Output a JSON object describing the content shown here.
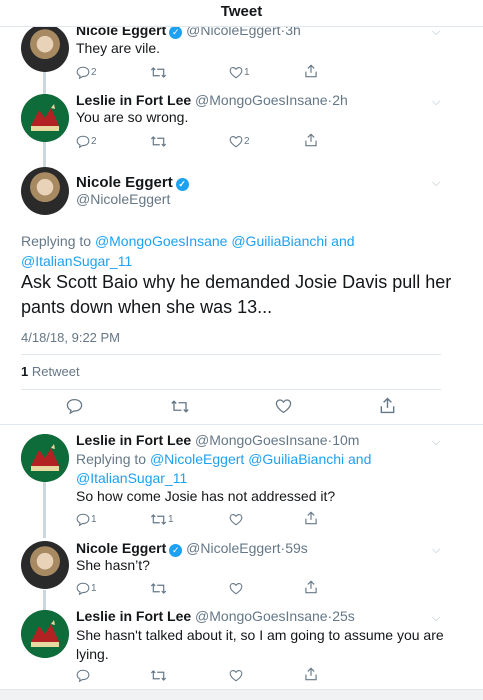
{
  "header": {
    "title": "Tweet"
  },
  "tweets_above": [
    {
      "name": "Nicole Eggert",
      "verified": true,
      "handle": "@NicoleEggert",
      "time": "3h",
      "text": "They are vile.",
      "reply_count": "2",
      "retweet_count": "",
      "like_count": "1"
    },
    {
      "name": "Leslie in Fort Lee",
      "verified": false,
      "handle": "@MongoGoesInsane",
      "time": "2h",
      "text": "You are so wrong.",
      "reply_count": "2",
      "retweet_count": "",
      "like_count": "2"
    }
  ],
  "focused": {
    "name": "Nicole Eggert",
    "handle": "@NicoleEggert",
    "replying_prefix": "Replying to",
    "replying_to": [
      "@MongoGoesInsane",
      "@GuiliaBianchi",
      "@ItalianSugar_11"
    ],
    "and": "and",
    "text": "Ask Scott Baio why he demanded Josie Davis pull her pants down when she was 13...",
    "timestamp": "4/18/18, 9:22 PM",
    "retweet_count": "1",
    "retweet_label": "Retweet"
  },
  "replies": [
    {
      "name": "Leslie in Fort Lee",
      "verified": false,
      "handle": "@MongoGoesInsane",
      "time": "10m",
      "replying_prefix": "Replying to",
      "replying_to": [
        "@NicoleEggert",
        "@GuiliaBianchi",
        "@ItalianSugar_11"
      ],
      "and": "and",
      "text": "So how come Josie has not addressed it?",
      "reply_count": "1",
      "retweet_count": "1",
      "like_count": ""
    },
    {
      "name": "Nicole Eggert",
      "verified": true,
      "handle": "@NicoleEggert",
      "time": "59s",
      "text": "She hasn’t?",
      "reply_count": "1",
      "retweet_count": "",
      "like_count": ""
    },
    {
      "name": "Leslie in Fort Lee",
      "verified": false,
      "handle": "@MongoGoesInsane",
      "time": "25s",
      "text": "She hasn't talked about it, so I am going to assume you are lying.",
      "reply_count": "",
      "retweet_count": "",
      "like_count": ""
    }
  ],
  "colors": {
    "link": "#1da1f2",
    "verified": "#1da1f2",
    "muted": "#657786",
    "thread_line": "#ccd6dd",
    "leslie_avatar_bg": "#0e6b3a"
  },
  "icons": [
    "reply-icon",
    "retweet-icon",
    "like-icon",
    "share-icon",
    "verified-badge-icon",
    "chevron-down-icon"
  ]
}
